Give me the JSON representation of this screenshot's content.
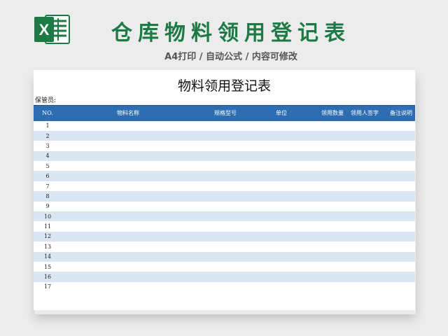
{
  "banner": {
    "title": "仓库物料领用登记表",
    "subtitle": "A4打印 / 自动公式 / 内容可修改",
    "logo_icon": "excel-icon",
    "title_color": "#1e7a45"
  },
  "sheet": {
    "title": "物料领用登记表",
    "keeper_label": "保管员:",
    "header_color": "#2d6db1",
    "alt_row_color": "#dbe6f3",
    "columns": [
      "NO.",
      "物料名称",
      "规格型号",
      "单位",
      "领用数量",
      "领用人签字",
      "备注说明"
    ],
    "rows": [
      "1",
      "2",
      "3",
      "4",
      "5",
      "6",
      "7",
      "8",
      "9",
      "10",
      "11",
      "12",
      "13",
      "14",
      "15",
      "16",
      "17"
    ]
  }
}
